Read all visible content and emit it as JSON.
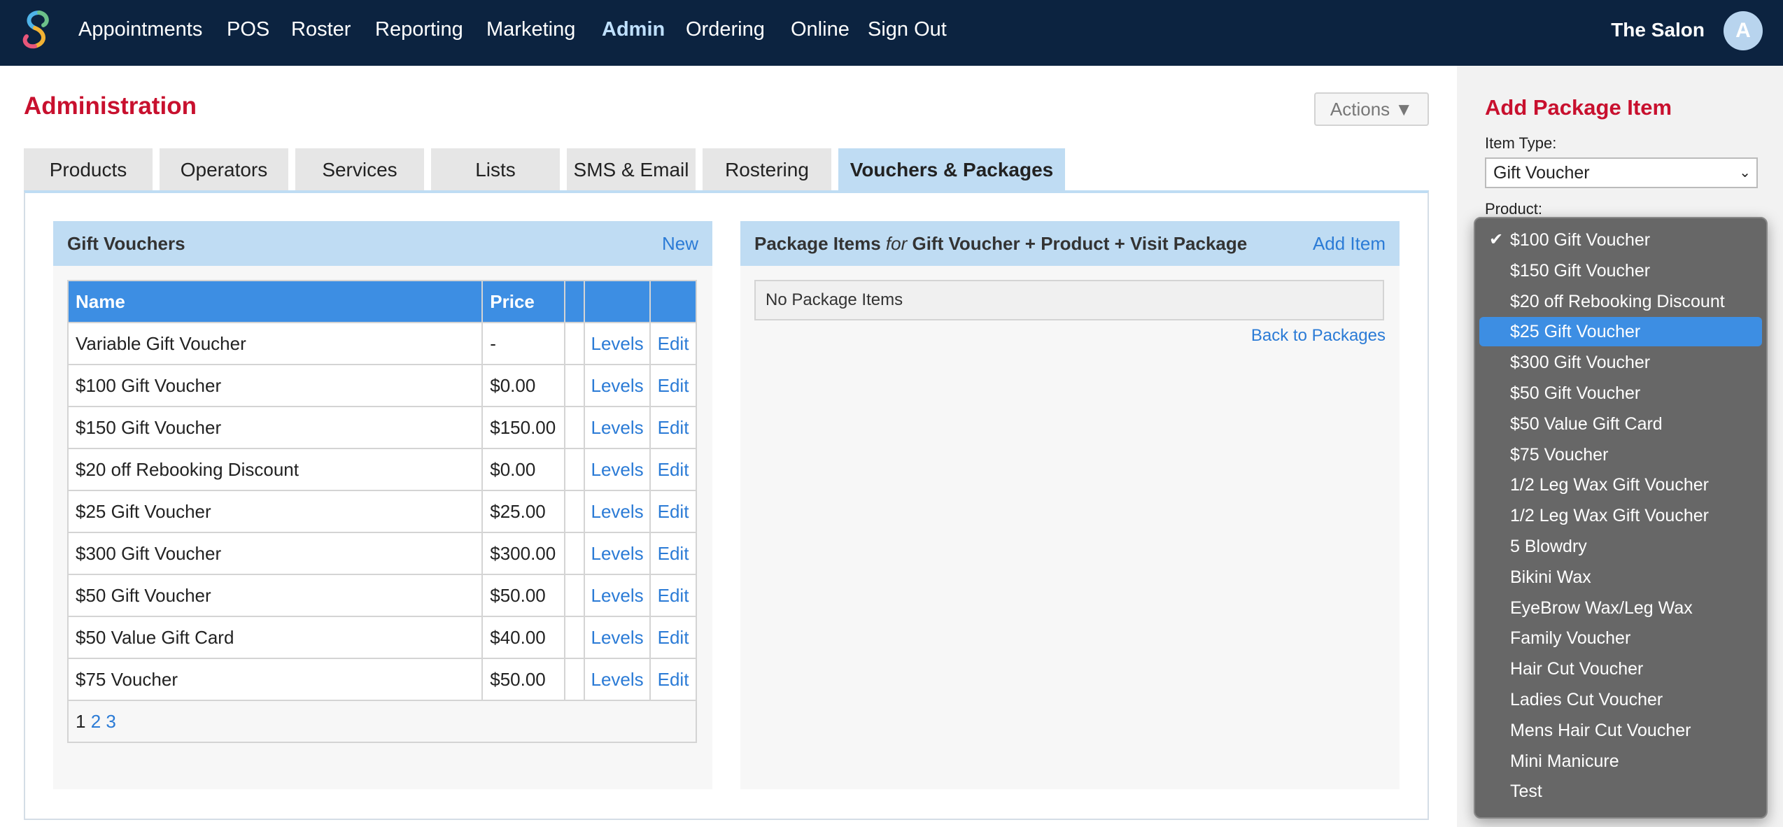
{
  "nav": {
    "items": [
      "Appointments",
      "POS",
      "Roster",
      "Reporting",
      "Marketing",
      "Admin",
      "Ordering",
      "Online",
      "Sign Out"
    ],
    "active": "Admin",
    "salon": "The Salon",
    "avatar_initial": "A"
  },
  "page": {
    "title": "Administration",
    "actions_label": "Actions ▼"
  },
  "tabs": [
    "Products",
    "Operators",
    "Services",
    "Lists",
    "SMS & Email",
    "Rostering",
    "Vouchers & Packages"
  ],
  "active_tab": "Vouchers & Packages",
  "gift_vouchers": {
    "title": "Gift Vouchers",
    "new_label": "New",
    "columns": [
      "Name",
      "Price",
      "",
      ""
    ],
    "levels_label": "Levels",
    "edit_label": "Edit",
    "rows": [
      {
        "name": "Variable Gift Voucher",
        "price": "-"
      },
      {
        "name": "$100 Gift Voucher",
        "price": "$0.00"
      },
      {
        "name": "$150 Gift Voucher",
        "price": "$150.00"
      },
      {
        "name": "$20 off Rebooking Discount",
        "price": "$0.00"
      },
      {
        "name": "$25 Gift Voucher",
        "price": "$25.00"
      },
      {
        "name": "$300 Gift Voucher",
        "price": "$300.00"
      },
      {
        "name": "$50 Gift Voucher",
        "price": "$50.00"
      },
      {
        "name": "$50 Value Gift Card",
        "price": "$40.00"
      },
      {
        "name": "$75 Voucher",
        "price": "$50.00"
      }
    ],
    "pager": {
      "current": "1",
      "pages": [
        "2",
        "3"
      ]
    }
  },
  "package_items": {
    "title_prefix": "Package Items",
    "title_for": "for",
    "title_package": "Gift Voucher + Product + Visit Package",
    "add_label": "Add Item",
    "empty_text": "No Package Items",
    "back_label": "Back to Packages"
  },
  "sidebar": {
    "title": "Add Package Item",
    "item_type_label": "Item Type:",
    "item_type_value": "Gift Voucher",
    "product_label": "Product:"
  },
  "dropdown": {
    "checked": "$100 Gift Voucher",
    "highlighted": "$25 Gift Voucher",
    "options": [
      "$100 Gift Voucher",
      "$150 Gift Voucher",
      "$20 off Rebooking Discount",
      "$25 Gift Voucher",
      "$300 Gift Voucher",
      "$50 Gift Voucher",
      "$50 Value Gift Card",
      "$75 Voucher",
      "1/2 Leg Wax Gift Voucher",
      "1/2 Leg Wax Gift Voucher",
      "5 Blowdry",
      "Bikini Wax",
      "EyeBrow Wax/Leg Wax",
      "Family Voucher",
      "Hair Cut Voucher",
      "Ladies Cut Voucher",
      "Mens Hair Cut Voucher",
      "Mini Manicure",
      "Test"
    ]
  },
  "colors": {
    "nav_bg": "#0c2340",
    "accent_red": "#c8102e",
    "link_blue": "#2b7bd6",
    "table_header": "#3d8ee3",
    "panel_header": "#bfdcf3"
  }
}
